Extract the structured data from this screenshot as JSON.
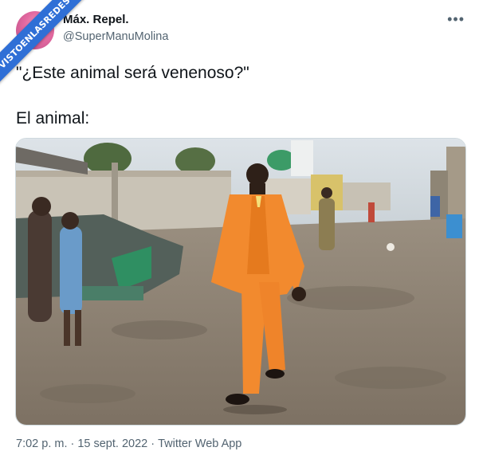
{
  "watermark": {
    "text": "VISTOENLASREDES"
  },
  "author": {
    "name": "Máx. Repel.",
    "handle": "@SuperManuMolina"
  },
  "menu": {
    "icon": "more-icon",
    "glyph": "•••"
  },
  "tweet": {
    "line1": "\"¿Este animal será venenoso?\"",
    "line2": "El animal:"
  },
  "meta": {
    "time": "7:02 p. m.",
    "date": "15 sept. 2022",
    "separator": "·",
    "source": "Twitter Web App"
  },
  "colors": {
    "text": "#0f1419",
    "secondary": "#536471",
    "watermark": "#2f6fd6",
    "suit": "#f28a2e"
  }
}
